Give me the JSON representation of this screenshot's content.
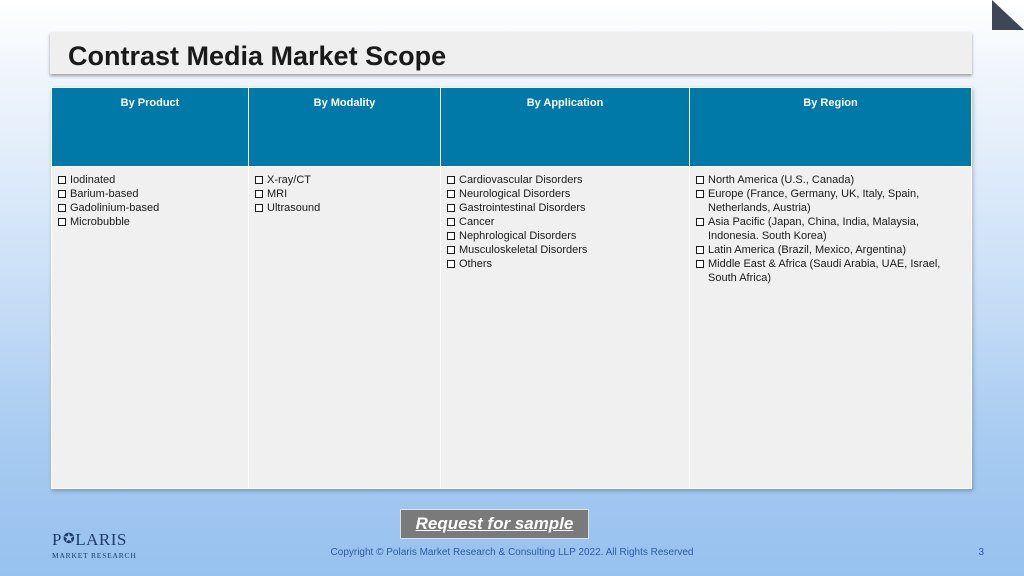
{
  "slide": {
    "title": "Contrast Media Market Scope",
    "page_number": "3"
  },
  "table": {
    "headers": [
      "By Product",
      "By Modality",
      "By Application",
      "By Region"
    ],
    "columns": [
      [
        "Iodinated",
        "Barium-based",
        "Gadolinium-based",
        "Microbubble"
      ],
      [
        "X-ray/CT",
        "MRI",
        "Ultrasound"
      ],
      [
        "Cardiovascular Disorders",
        "Neurological Disorders",
        "Gastrointestinal Disorders",
        "Cancer",
        "Nephrological Disorders",
        "Musculoskeletal Disorders",
        "Others"
      ],
      [
        "North America (U.S., Canada)",
        "Europe (France, Germany, UK, Italy, Spain, Netherlands, Austria)",
        "Asia Pacific (Japan, China, India, Malaysia, Indonesia. South Korea)",
        "Latin America (Brazil, Mexico, Argentina)",
        "Middle East & Africa (Saudi Arabia, UAE, Israel, South Africa)"
      ]
    ]
  },
  "cta": {
    "label": "Request for sample"
  },
  "logo": {
    "name_pre": "P",
    "name_post": "LARIS",
    "sub": "MARKET RESEARCH"
  },
  "footer": {
    "copyright": "Copyright © Polaris Market Research & Consulting LLP 2022. All Rights Reserved"
  },
  "colors": {
    "header_bg": "#0079a8",
    "cell_bg": "#f0f0f0",
    "brand": "#1f3c70",
    "footer_text": "#2f5aa7"
  },
  "icons": {
    "bullet": "checkbox-bullet-icon",
    "corner": "corner-fold-icon",
    "logo_star": "star-icon"
  }
}
